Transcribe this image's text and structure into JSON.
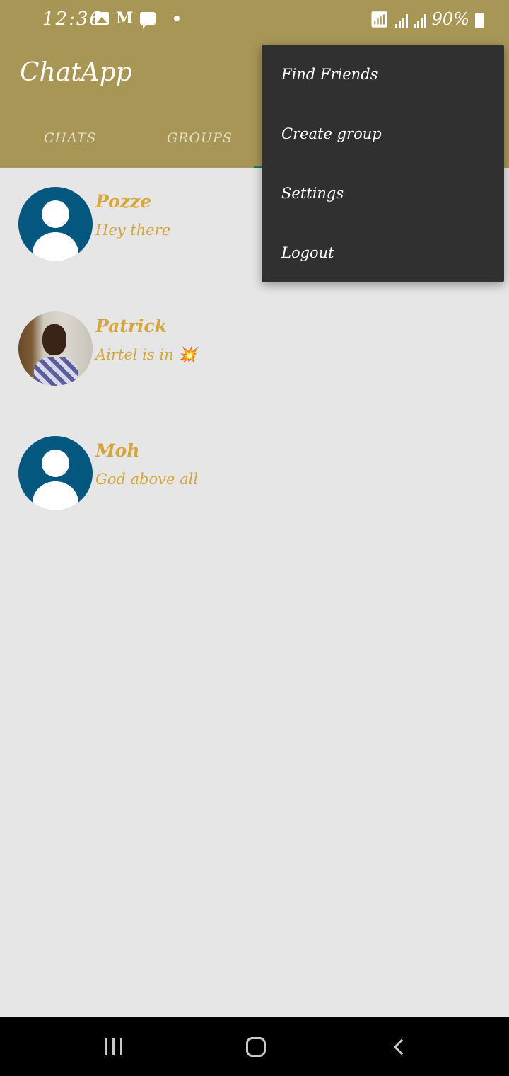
{
  "status_bar": {
    "time": "12:36",
    "left_icons": [
      "gallery-icon",
      "gmail-icon",
      "message-icon",
      "dot-icon"
    ],
    "right_icons": [
      "wifi-icon",
      "signal-icon",
      "signal-icon",
      "battery-icon"
    ],
    "battery": "90%"
  },
  "app": {
    "title": "ChatApp",
    "brand_color": "#a89656"
  },
  "tabs": [
    {
      "label": "CHATS"
    },
    {
      "label": "GROUPS"
    }
  ],
  "chats": [
    {
      "name": "Pozze",
      "status": "Hey there",
      "avatar": "default-avatar-icon"
    },
    {
      "name": "Patrick",
      "status": "Airtel is in 💥",
      "avatar": "profile-photo"
    },
    {
      "name": "Moh",
      "status": "God above all",
      "avatar": "default-avatar-icon"
    }
  ],
  "menu": {
    "items": [
      {
        "label": "Find Friends"
      },
      {
        "label": "Create group"
      },
      {
        "label": "Settings"
      },
      {
        "label": "Logout"
      }
    ]
  },
  "nav_bar": {
    "buttons": [
      "recents-icon",
      "home-icon",
      "back-icon"
    ]
  },
  "colors": {
    "accent": "#d6a53c",
    "avatar_bg": "#04577f",
    "menu_bg": "#303030"
  }
}
